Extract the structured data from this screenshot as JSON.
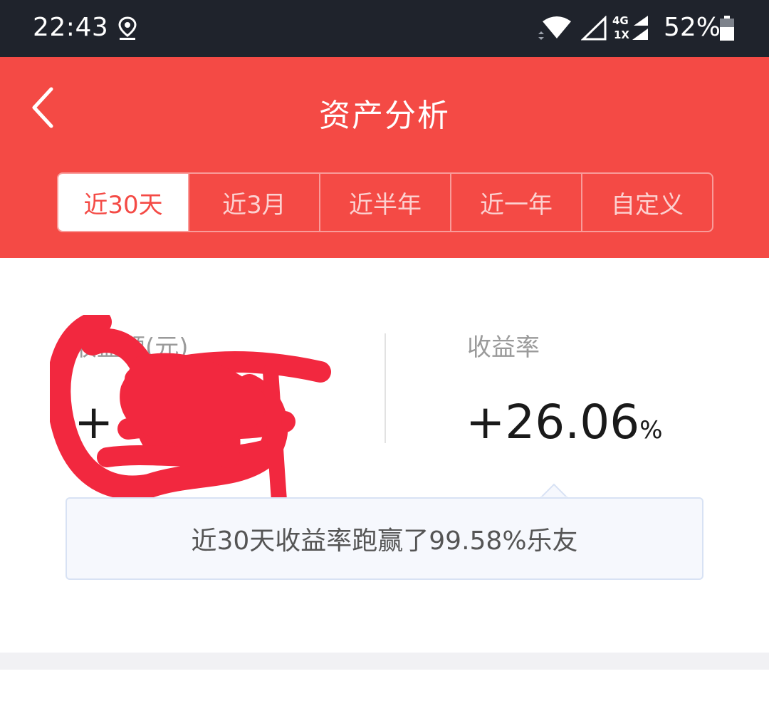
{
  "status_bar": {
    "time": "22:43",
    "network_top": "4G",
    "network_bottom": "1X",
    "battery": "52%"
  },
  "header": {
    "title": "资产分析",
    "tabs": [
      {
        "label": "近30天",
        "active": true
      },
      {
        "label": "近3月",
        "active": false
      },
      {
        "label": "近半年",
        "active": false
      },
      {
        "label": "近一年",
        "active": false
      },
      {
        "label": "自定义",
        "active": false
      }
    ]
  },
  "summary": {
    "earnings": {
      "label": "收益额(元)",
      "value": "+  2"
    },
    "yield_rate": {
      "label": "收益率",
      "value": "+26.06",
      "unit": "%"
    },
    "tip": "近30天收益率跑赢了99.58%乐友"
  },
  "colors": {
    "accent": "#f44a45",
    "status_bar": "#1f232c",
    "scribble": "#f2283f",
    "tip_background": "#f6f8fd",
    "tip_border": "#d8e2f4"
  }
}
